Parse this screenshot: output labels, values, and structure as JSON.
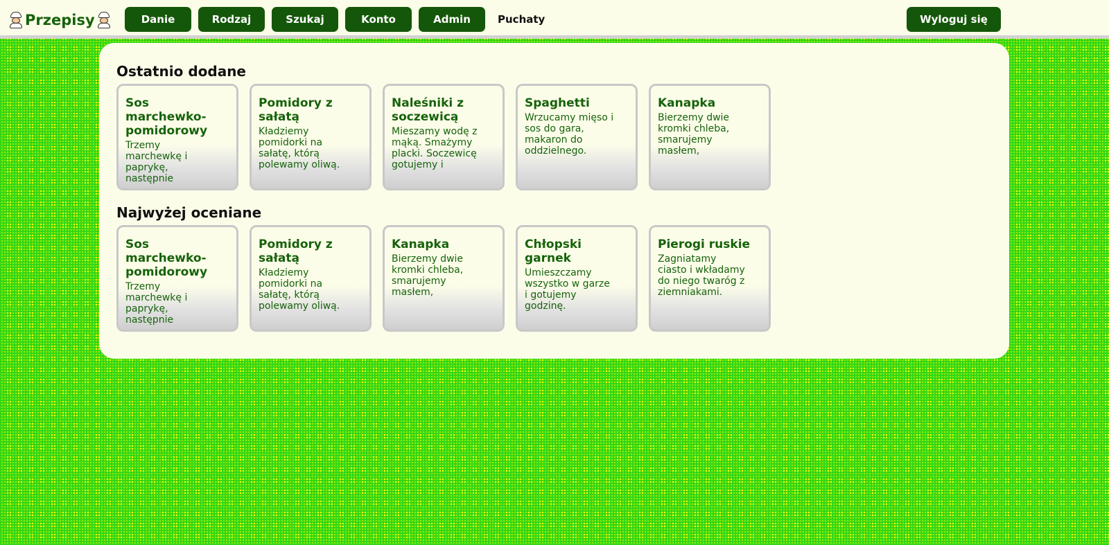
{
  "header": {
    "logo_text": "Przepisy",
    "nav": [
      {
        "label": "Danie"
      },
      {
        "label": "Rodzaj"
      },
      {
        "label": "Szukaj"
      },
      {
        "label": "Konto"
      },
      {
        "label": "Admin"
      }
    ],
    "username": "Puchaty",
    "logout_label": "Wyloguj się"
  },
  "sections": [
    {
      "title": "Ostatnio dodane",
      "recipes": [
        {
          "title": "Sos marchewko-pomidorowy",
          "description": "Trzemy marchewkę i paprykę, następnie"
        },
        {
          "title": "Pomidory z sałatą",
          "description": "Kładziemy pomidorki na sałatę, którą polewamy oliwą."
        },
        {
          "title": "Naleśniki z soczewicą",
          "description": "Mieszamy wodę z mąką. Smażymy placki. Soczewicę gotujemy i"
        },
        {
          "title": "Spaghetti",
          "description": "Wrzucamy mięso i sos do gara, makaron do oddzielnego."
        },
        {
          "title": "Kanapka",
          "description": "Bierzemy dwie kromki chleba, smarujemy masłem,"
        }
      ]
    },
    {
      "title": "Najwyżej oceniane",
      "recipes": [
        {
          "title": "Sos marchewko-pomidorowy",
          "description": "Trzemy marchewkę i paprykę, następnie"
        },
        {
          "title": "Pomidory z sałatą",
          "description": "Kładziemy pomidorki na sałatę, którą polewamy oliwą."
        },
        {
          "title": "Kanapka",
          "description": "Bierzemy dwie kromki chleba, smarujemy masłem,"
        },
        {
          "title": "Chłopski garnek",
          "description": "Umieszczamy wszystko w garze i gotujemy godzinę."
        },
        {
          "title": "Pierogi ruskie",
          "description": "Zagniatamy ciasto i wkładamy do niego twaróg z ziemniakami."
        }
      ]
    }
  ],
  "colors": {
    "accent": "#15570a",
    "text_green": "#16620b",
    "panel_bg": "#fcfde9",
    "tablecloth_yellow": "#ffff00",
    "tablecloth_green": "#30d818"
  },
  "icons": [
    "chef-icon"
  ]
}
